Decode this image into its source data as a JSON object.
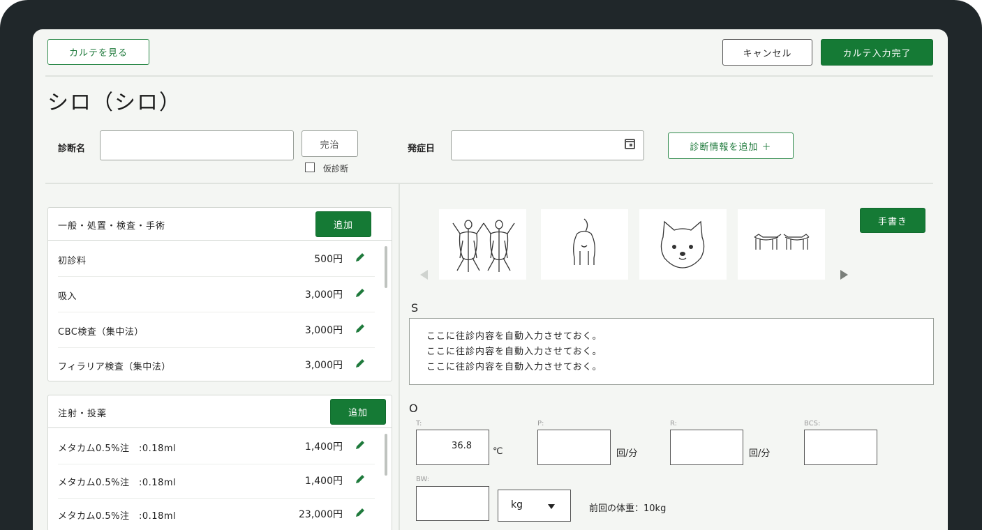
{
  "header": {
    "view_chart_label": "カルテを見る",
    "cancel_label": "キャンセル",
    "complete_label": "カルテ入力完了"
  },
  "patient": {
    "name": "シロ（シロ）"
  },
  "diagnosis": {
    "name_label": "診断名",
    "name_value": "",
    "cured_label": "完治",
    "tentative_label": "仮診断",
    "onset_label": "発症日",
    "onset_value": "",
    "add_label": "診断情報を追加 ＋"
  },
  "treatments": {
    "title": "一般・処置・検査・手術",
    "add_label": "追加",
    "items": [
      {
        "name": "初診料",
        "price": "500円"
      },
      {
        "name": "吸入",
        "price": "3,000円"
      },
      {
        "name": "CBC検査（集中法）",
        "price": "3,000円"
      },
      {
        "name": "フィラリア検査（集中法）",
        "price": "3,000円"
      }
    ]
  },
  "injections": {
    "title": "注射・投薬",
    "add_label": "追加",
    "items": [
      {
        "name": "メタカム0.5%注　:0.18ml",
        "price": "1,400円"
      },
      {
        "name": "メタカム0.5%注　:0.18ml",
        "price": "1,400円"
      },
      {
        "name": "メタカム0.5%注　:0.18ml",
        "price": "23,000円"
      }
    ]
  },
  "schema": {
    "handwrite_label": "手書き",
    "thumbnails": [
      "dog-body-top-view-icon",
      "dog-rear-view-icon",
      "dog-face-icon",
      "dog-side-view-icon"
    ]
  },
  "soap": {
    "s_label": "S",
    "s_lines": [
      "ここに往診内容を自動入力させておく。",
      "ここに往診内容を自動入力させておく。",
      "ここに往診内容を自動入力させておく。"
    ],
    "o_label": "O",
    "t_label": "T:",
    "t_value": "36.8",
    "t_unit": "℃",
    "p_label": "P:",
    "p_value": "",
    "p_unit": "回/分",
    "r_label": "R:",
    "r_value": "",
    "r_unit": "回/分",
    "bcs_label": "BCS:",
    "bcs_value": "",
    "bw_label": "BW:",
    "bw_value": "",
    "bw_unit": "kg",
    "prev_weight": "前回の体重：10kg"
  },
  "colors": {
    "accent": "#157a35",
    "frame": "#20272a",
    "background": "#f4f6f3"
  }
}
